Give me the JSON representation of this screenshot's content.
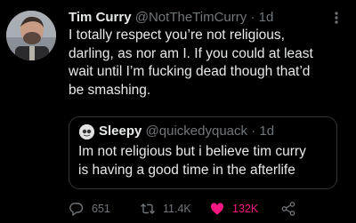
{
  "tweet": {
    "name": "Tim Curry",
    "handle": "@NotTheTimCurry",
    "separator": "·",
    "time": "1d",
    "text": "I totally respect you’re not religious,\ndarling, as nor am I. If you could at least\nwait until I’m fucking dead though that’d\nbe smashing."
  },
  "quoted_tweet": {
    "name": "Sleepy",
    "handle": "@quickedyquack",
    "separator": "·",
    "time": "1d",
    "text": "Im not religious but i believe tim curry\nis having a good time in the afterlife"
  },
  "actions": {
    "replies": "651",
    "retweets": "11.4K",
    "likes": "132K",
    "liked": true
  },
  "icons": {
    "more": "more-dots-icon",
    "reply": "reply-bubble-icon",
    "retweet": "retweet-arrows-icon",
    "like": "heart-icon",
    "share": "share-icon"
  },
  "colors": {
    "background": "#000000",
    "text": "#e7e9ea",
    "muted": "#71767b",
    "like": "#f91880",
    "border": "#2f3336"
  }
}
